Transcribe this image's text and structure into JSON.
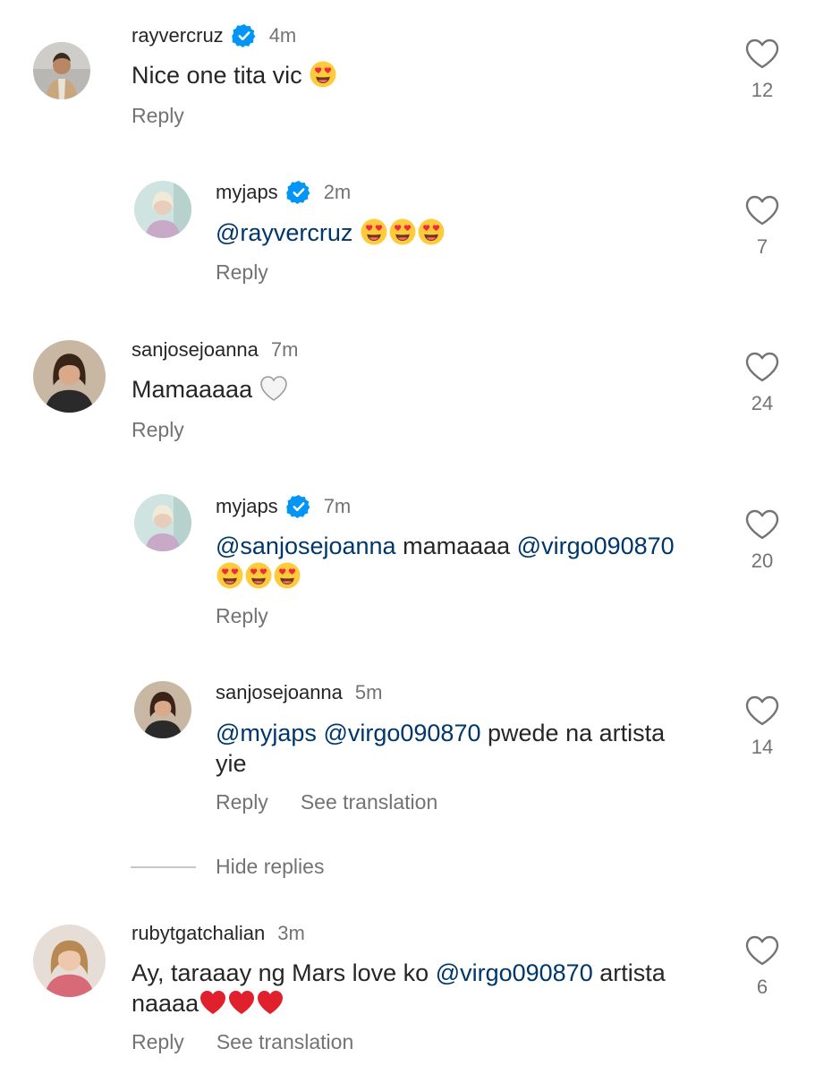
{
  "comments": [
    {
      "username": "rayvercruz",
      "verified": true,
      "time": "4m",
      "text": "Nice one tita vic",
      "emojis": [
        "heart-eyes"
      ],
      "reply_label": "Reply",
      "likes": "12"
    },
    {
      "username": "myjaps",
      "verified": true,
      "time": "2m",
      "mention": "@rayvercruz",
      "emojis": [
        "heart-eyes",
        "heart-eyes",
        "heart-eyes"
      ],
      "reply_label": "Reply",
      "likes": "7"
    },
    {
      "username": "sanjosejoanna",
      "verified": false,
      "time": "7m",
      "text": "Mamaaaaa",
      "emojis": [
        "white-heart"
      ],
      "reply_label": "Reply",
      "likes": "24"
    },
    {
      "username": "myjaps",
      "verified": true,
      "time": "7m",
      "mention1": "@sanjosejoanna",
      "text": "mamaaaa",
      "mention2": "@virgo090870",
      "emojis": [
        "heart-eyes",
        "heart-eyes",
        "heart-eyes"
      ],
      "reply_label": "Reply",
      "likes": "20"
    },
    {
      "username": "sanjosejoanna",
      "verified": false,
      "time": "5m",
      "mention1": "@myjaps",
      "mention2": "@virgo090870",
      "text_line1": "pwede na artista",
      "text_line2": "yie",
      "reply_label": "Reply",
      "translate_label": "See translation",
      "likes": "14"
    },
    {
      "username": "rubytgatchalian",
      "verified": false,
      "time": "3m",
      "text_line1": "Ay, taraaay ng Mars love ko",
      "mention": "@virgo090870",
      "text_line1_end": "artista",
      "text_line2": "naaaa",
      "emojis": [
        "red-heart",
        "red-heart",
        "red-heart"
      ],
      "reply_label": "Reply",
      "translate_label": "See translation",
      "likes": "6"
    }
  ],
  "hide_replies_label": "Hide replies",
  "colors": {
    "text": "#262626",
    "secondary": "#737373",
    "mention": "#00376b",
    "verified": "#0095f6",
    "red_heart": "#e0202c"
  }
}
